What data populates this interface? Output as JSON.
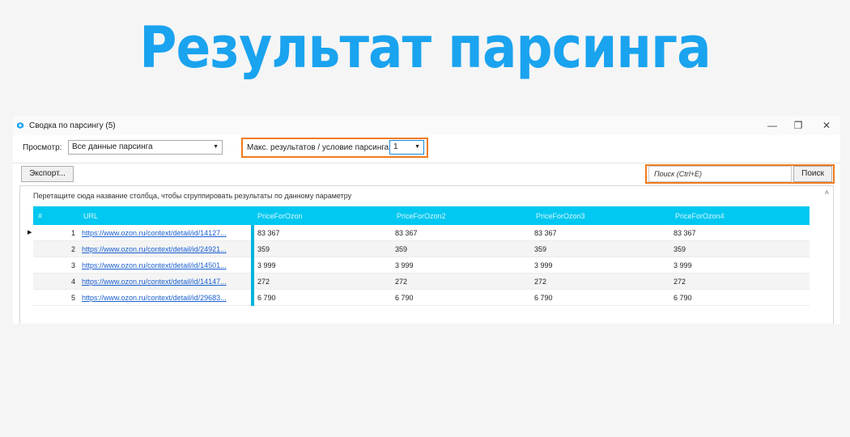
{
  "headline": "Результат парсинга",
  "window": {
    "title": "Сводка по парсингу (5)",
    "controls": {
      "minimize": "—",
      "restore": "❐",
      "close": "✕"
    }
  },
  "toolbar": {
    "view_label": "Просмотр:",
    "view_value": "Все данные парсинга",
    "max_results_label": "Макс. результатов / условие парсинга:",
    "max_results_value": "1",
    "export_label": "Экспорт...",
    "search_placeholder": "Поиск (Ctrl+E)",
    "search_button": "Поиск"
  },
  "grid": {
    "group_hint": "Перетащите сюда название столбца, чтобы сгруппировать результаты по данному параметру",
    "columns": [
      "#",
      "URL",
      "PriceForOzon",
      "PriceForOzon2",
      "PriceForOzon3",
      "PriceForOzon4"
    ],
    "rows": [
      {
        "n": "1",
        "url": "https://www.ozon.ru/context/detail/id/14127...",
        "p1": "83 367",
        "p2": "83 367",
        "p3": "83 367",
        "p4": "83 367"
      },
      {
        "n": "2",
        "url": "https://www.ozon.ru/context/detail/id/24921...",
        "p1": "359",
        "p2": "359",
        "p3": "359",
        "p4": "359"
      },
      {
        "n": "3",
        "url": "https://www.ozon.ru/context/detail/id/14501...",
        "p1": "3 999",
        "p2": "3 999",
        "p3": "3 999",
        "p4": "3 999"
      },
      {
        "n": "4",
        "url": "https://www.ozon.ru/context/detail/id/14147...",
        "p1": "272",
        "p2": "272",
        "p3": "272",
        "p4": "272"
      },
      {
        "n": "5",
        "url": "https://www.ozon.ru/context/detail/id/29683...",
        "p1": "6 790",
        "p2": "6 790",
        "p3": "6 790",
        "p4": "6 790"
      }
    ]
  },
  "colors": {
    "accent": "#1aa3ef",
    "header": "#00c8f0",
    "highlight": "#f07b1d"
  }
}
